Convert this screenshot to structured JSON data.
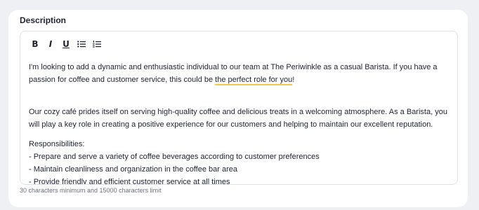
{
  "field": {
    "label": "Description",
    "helper_text": "30 characters minimum and 15000 characters limit"
  },
  "toolbar": {
    "bold": {
      "glyph": "B",
      "icon": "bold-icon"
    },
    "italic": {
      "glyph": "I",
      "icon": "italic-icon"
    },
    "underline": {
      "glyph": "U",
      "icon": "underline-icon"
    },
    "bullet_list": {
      "icon": "bulleted-list-icon"
    },
    "numbered_list": {
      "icon": "numbered-list-icon"
    }
  },
  "content": {
    "intro_start": "I'm looking to add a dynamic and enthusiastic individual to our team at The Periwinkle as a casual Barista. If you have a passion for coffee and customer service, this could be ",
    "intro_highlight": "the perfect role for you",
    "intro_end": "!",
    "paragraph2": "Our cozy café prides itself on serving high-quality coffee and delicious treats in a welcoming atmosphere. As a Barista, you will play a key role in creating a positive experience for our customers and helping to maintain our excellent reputation.",
    "responsibilities_heading": "Responsibilities:",
    "responsibilities": [
      "- Prepare and serve a variety of coffee beverages according to customer preferences",
      "- Maintain cleanliness and organization in the coffee bar area",
      "- Provide friendly and efficient customer service at all times"
    ]
  },
  "colors": {
    "text": "#1f2433",
    "border": "#dfe2e8",
    "highlight_underline": "#f2c94c",
    "helper": "#6b7280",
    "page_bg": "#eef0f3"
  }
}
